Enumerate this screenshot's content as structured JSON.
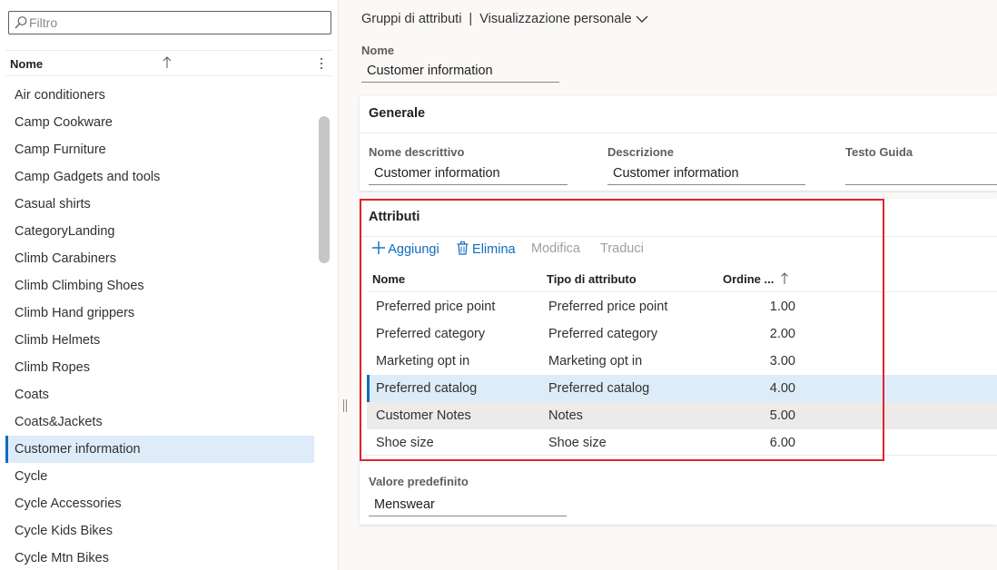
{
  "filter": {
    "placeholder": "Filtro",
    "value": ""
  },
  "list": {
    "column_header": "Nome",
    "items": [
      "Air conditioners",
      "Camp Cookware",
      "Camp Furniture",
      "Camp Gadgets and tools",
      "Casual shirts",
      "CategoryLanding",
      "Climb Carabiners",
      "Climb Climbing Shoes",
      "Climb Hand grippers",
      "Climb Helmets",
      "Climb Ropes",
      "Coats",
      "Coats&Jackets",
      "Customer information",
      "Cycle",
      "Cycle Accessories",
      "Cycle Kids Bikes",
      "Cycle Mtn Bikes"
    ],
    "selected": "Customer information"
  },
  "breadcrumb": {
    "page": "Gruppi di attributi",
    "separator": "|",
    "view": "Visualizzazione personale"
  },
  "header_field": {
    "label": "Nome",
    "value": "Customer information"
  },
  "generale": {
    "title": "Generale",
    "fields": [
      {
        "label": "Nome descrittivo",
        "value": "Customer information"
      },
      {
        "label": "Descrizione",
        "value": "Customer information"
      },
      {
        "label": "Testo Guida",
        "value": ""
      }
    ]
  },
  "attributi": {
    "title": "Attributi",
    "toolbar": {
      "add": "Aggiungi",
      "delete": "Elimina",
      "edit": "Modifica",
      "translate": "Traduci"
    },
    "columns": [
      "Nome",
      "Tipo di attributo",
      "Ordine ..."
    ],
    "rows": [
      {
        "name": "Preferred price point",
        "type": "Preferred price point",
        "order": "1.00"
      },
      {
        "name": "Preferred category",
        "type": "Preferred category",
        "order": "2.00"
      },
      {
        "name": "Marketing opt in",
        "type": "Marketing opt in",
        "order": "3.00"
      },
      {
        "name": "Preferred catalog",
        "type": "Preferred catalog",
        "order": "4.00"
      },
      {
        "name": "Customer Notes",
        "type": "Notes",
        "order": "5.00"
      },
      {
        "name": "Shoe size",
        "type": "Shoe size",
        "order": "6.00"
      }
    ],
    "selected_row": "Preferred catalog",
    "hovered_row": "Customer Notes"
  },
  "default_value": {
    "label": "Valore predefinito",
    "value": "Menswear"
  },
  "colors": {
    "accent": "#0f6cbd",
    "selection": "#deecf9",
    "highlight_outline": "#e0232d",
    "disabled": "#a19f9d"
  },
  "icons": [
    "search-icon",
    "sort-ascending-icon",
    "more-vertical-icon",
    "chevron-down-icon",
    "add-icon",
    "trash-icon",
    "splitter-grip-icon"
  ]
}
